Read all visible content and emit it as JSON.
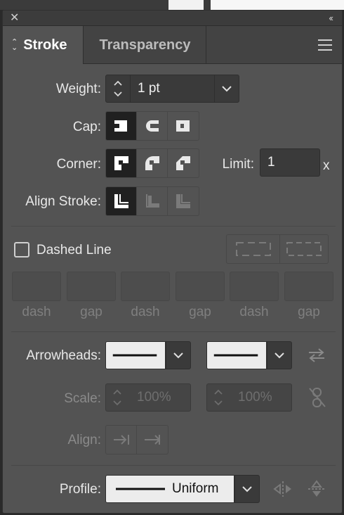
{
  "panel": {
    "tabs": [
      {
        "label": "Stroke"
      },
      {
        "label": "Transparency"
      }
    ]
  },
  "weight": {
    "label": "Weight:",
    "value": "1 pt"
  },
  "cap": {
    "label": "Cap:"
  },
  "corner": {
    "label": "Corner:",
    "limit_label": "Limit:",
    "limit_value": "1",
    "limit_unit": "x"
  },
  "align_stroke": {
    "label": "Align Stroke:"
  },
  "dashed": {
    "label": "Dashed Line",
    "checked": false,
    "fields": [
      "dash",
      "gap",
      "dash",
      "gap",
      "dash",
      "gap"
    ]
  },
  "arrowheads": {
    "label": "Arrowheads:"
  },
  "scale": {
    "label": "Scale:",
    "start": "100%",
    "end": "100%"
  },
  "align": {
    "label": "Align:"
  },
  "profile": {
    "label": "Profile:",
    "value": "Uniform"
  }
}
